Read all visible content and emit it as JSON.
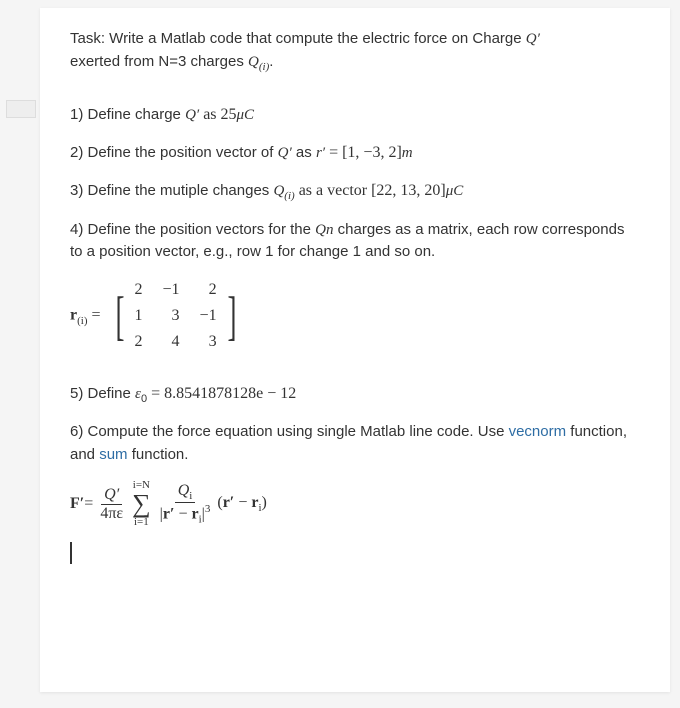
{
  "task_line1": "Task: Write a Matlab code that compute the electric force on Charge ",
  "task_Q": "Q′",
  "task_line2": "exerted from N=3 charges ",
  "task_Qi": "Q",
  "task_Qi_sub": "(i)",
  "task_period": ".",
  "step1_a": "1) Define charge ",
  "step1_Q": "Q′",
  "step1_b": " as 25",
  "step1_unit": "μC",
  "step2_a": "2) Define the position vector of ",
  "step2_Q": "Q′",
  "step2_b": " as ",
  "step2_r": "r′",
  "step2_c": " = [1, −3, 2]",
  "step2_unit": "m",
  "step3_a": "3) Define the mutiple changes ",
  "step3_Q": "Q",
  "step3_Qsub": "(i)",
  "step3_b": " as a vector [22, 13, 20]",
  "step3_unit": "μC",
  "step4_a": "4) Define the position vectors for the ",
  "step4_Qn": "Qn",
  "step4_b": " charges as a matrix, each row corresponds to a position vector, e.g., row 1 for change 1 and so on.",
  "matrix_label_r": "r",
  "matrix_label_sub": "(i)",
  "matrix_eq": " = ",
  "matrix": {
    "r1c1": "2",
    "r1c2": "−1",
    "r1c3": "2",
    "r2c1": "1",
    "r2c2": "3",
    "r2c3": "−1",
    "r3c1": "2",
    "r3c2": "4",
    "r3c3": "3"
  },
  "step5_a": "5) Define ",
  "step5_eps": "ε",
  "step5_eps_sub": "0",
  "step5_b": " = 8.8541878128e − 12",
  "step6_a": "6) Compute the force equation using single Matlab line code. Use ",
  "step6_vecnorm": "vecnorm",
  "step6_b": " function, and ",
  "step6_sum": "sum",
  "step6_c": " function.",
  "formula": {
    "F": "F′",
    "eq": " = ",
    "frac1_num": "Q′",
    "frac1_den_a": "4πε",
    "sigma_top": "i=N",
    "sigma": "∑",
    "sigma_bot": "i=1",
    "frac2_num": "Q",
    "frac2_num_sub": "i",
    "frac2_den_a": "|",
    "frac2_den_r1": "r′",
    "frac2_den_mid": " − ",
    "frac2_den_r2": "r",
    "frac2_den_r2sub": "i",
    "frac2_den_b": "|",
    "frac2_den_pow": "3",
    "tail_a": "(",
    "tail_r1": "r′",
    "tail_mid": " − ",
    "tail_r2": "r",
    "tail_r2sub": "i",
    "tail_b": ")"
  }
}
